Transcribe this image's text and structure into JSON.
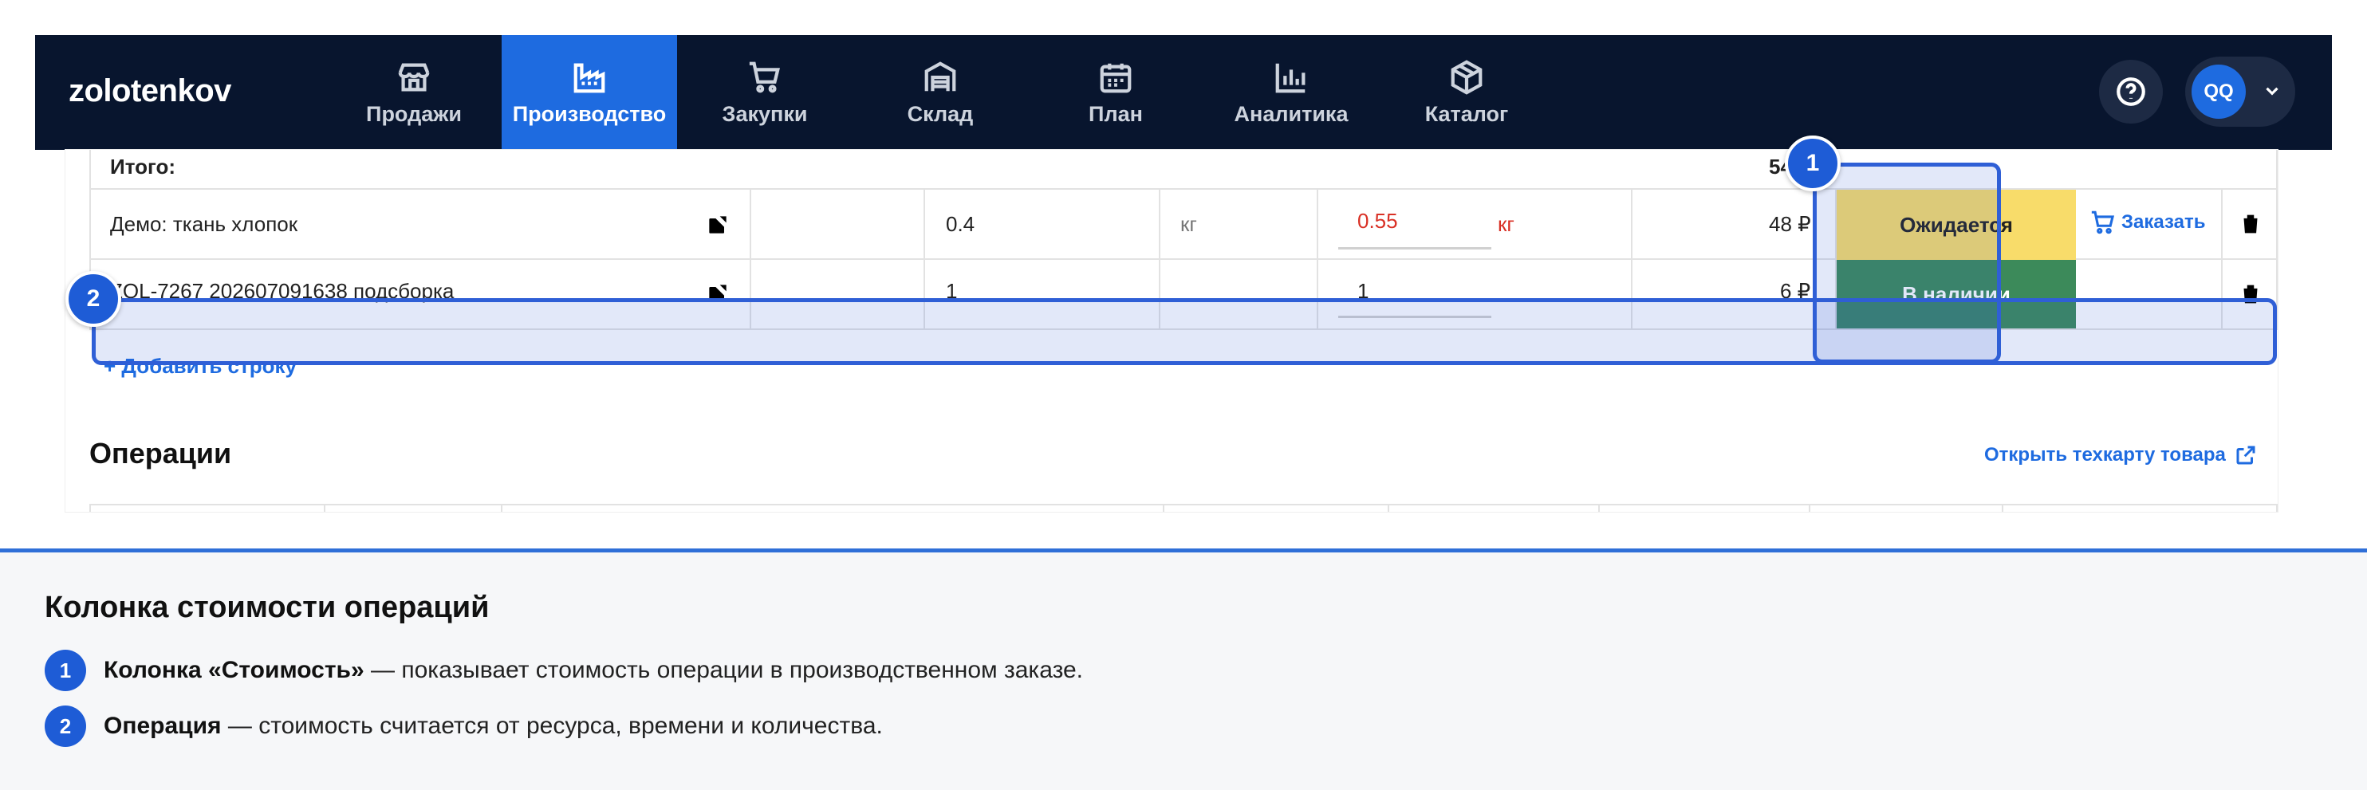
{
  "app": {
    "logo": "zolotenkov"
  },
  "nav": [
    {
      "label": "Продажи",
      "icon": "store-icon",
      "active": false
    },
    {
      "label": "Производство",
      "icon": "factory-icon",
      "active": true
    },
    {
      "label": "Закупки",
      "icon": "cart-icon",
      "active": false
    },
    {
      "label": "Склад",
      "icon": "warehouse-icon",
      "active": false
    },
    {
      "label": "План",
      "icon": "calendar-icon",
      "active": false
    },
    {
      "label": "Аналитика",
      "icon": "chart-icon",
      "active": false
    },
    {
      "label": "Каталог",
      "icon": "box-icon",
      "active": false
    }
  ],
  "user": {
    "initials": "QQ"
  },
  "table": {
    "total_label": "Итого:",
    "total_value": "54",
    "rows": [
      {
        "name": "Демо: ткань хлопок",
        "qty": "0.4",
        "unit": "кг",
        "used": "0.55",
        "used_unit": "кг",
        "cost": "48 ₽",
        "status": "Ожидается",
        "action": "Заказать"
      },
      {
        "name": "ZOL-7267 202607091638 подсборка",
        "qty": "1",
        "unit": "",
        "used": "1",
        "used_unit": "",
        "cost": "6 ₽",
        "status": "В наличии",
        "action": ""
      }
    ],
    "add_row": "+ Добавить строку"
  },
  "operations": {
    "title": "Операции",
    "open_link": "Открыть техкарту товара"
  },
  "colors": {
    "nav_bg": "#08152e",
    "accent": "#1e6be0",
    "status_waiting": "#f8dc6a",
    "status_instock": "#3c8a5a",
    "warn_text": "#d93025"
  },
  "legend": {
    "title": "Колонка стоимости операций",
    "items": [
      {
        "num": "1",
        "term": "Колонка «Стоимость»",
        "desc": " — показывает стоимость операции в производственном заказе."
      },
      {
        "num": "2",
        "term": "Операция",
        "desc": " — стоимость считается от ресурса, времени и количества."
      }
    ]
  }
}
